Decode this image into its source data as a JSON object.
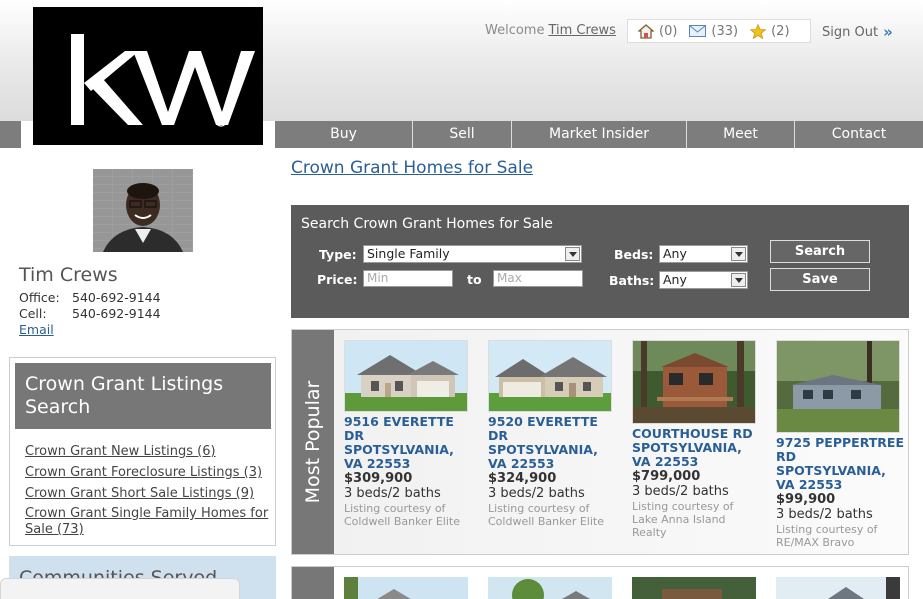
{
  "header": {
    "welcome_prefix": "Welcome",
    "user_name": "Tim Crews",
    "saved_homes_count": "(0)",
    "messages_count": "(33)",
    "favorites_count": "(2)",
    "sign_out": "Sign Out",
    "sign_out_arrow": "»"
  },
  "logo": {
    "text": "KW",
    "registered": "®",
    "background": "#000000"
  },
  "nav": {
    "items": [
      {
        "label": "Buy"
      },
      {
        "label": "Sell"
      },
      {
        "label": "Market Insider"
      },
      {
        "label": "Meet"
      },
      {
        "label": "Contact"
      }
    ]
  },
  "agent": {
    "name": "Tim Crews",
    "office_label": "Office:",
    "office_phone": "540-692-9144",
    "cell_label": "Cell:",
    "cell_phone": "540-692-9144",
    "email_link": "Email"
  },
  "listings_panel": {
    "title": "Crown Grant Listings Search",
    "links": [
      {
        "label": "Crown Grant New Listings (6)"
      },
      {
        "label": "Crown Grant Foreclosure Listings (3)"
      },
      {
        "label": "Crown Grant Short Sale Listings (9)"
      },
      {
        "label": "Crown Grant Single Family Homes for Sale (73)"
      }
    ]
  },
  "communities_panel": {
    "title": "Communities Served"
  },
  "page_title": "Crown Grant Homes for Sale",
  "search": {
    "title": "Search Crown Grant Homes for Sale",
    "type_label": "Type:",
    "type_value": "Single Family",
    "price_label": "Price:",
    "min_placeholder": "Min",
    "to_label": "to",
    "max_placeholder": "Max",
    "beds_label": "Beds:",
    "beds_value": "Any",
    "baths_label": "Baths:",
    "baths_value": "Any",
    "search_button": "Search",
    "save_button": "Save"
  },
  "most_popular": {
    "label": "Most Popular",
    "listings": [
      {
        "address": "9516 EVERETTE DR SPOTSYLVANIA, VA 22553",
        "price": "$309,900",
        "beds_baths": "3 beds/2 baths",
        "courtesy": "Listing courtesy of Coldwell Banker Elite"
      },
      {
        "address": "9520 EVERETTE DR SPOTSYLVANIA, VA 22553",
        "price": "$324,900",
        "beds_baths": "3 beds/2 baths",
        "courtesy": "Listing courtesy of Coldwell Banker Elite"
      },
      {
        "address": "COURTHOUSE RD SPOTSYLVANIA, VA 22553",
        "price": "$799,000",
        "beds_baths": "3 beds/2 baths",
        "courtesy": "Listing courtesy of Lake Anna Island Realty"
      },
      {
        "address": "9725 PEPPERTREE RD SPOTSYLVANIA, VA 22553",
        "price": "$99,900",
        "beds_baths": "3 beds/2 baths",
        "courtesy": "Listing courtesy of RE/MAX Bravo"
      }
    ]
  },
  "colors": {
    "nav_gray": "#7d7d7d",
    "link_blue": "#2a5f96",
    "search_bg": "#5b5b5b",
    "panel_gray": "#777777",
    "communities_bg": "#cfe0ef"
  }
}
